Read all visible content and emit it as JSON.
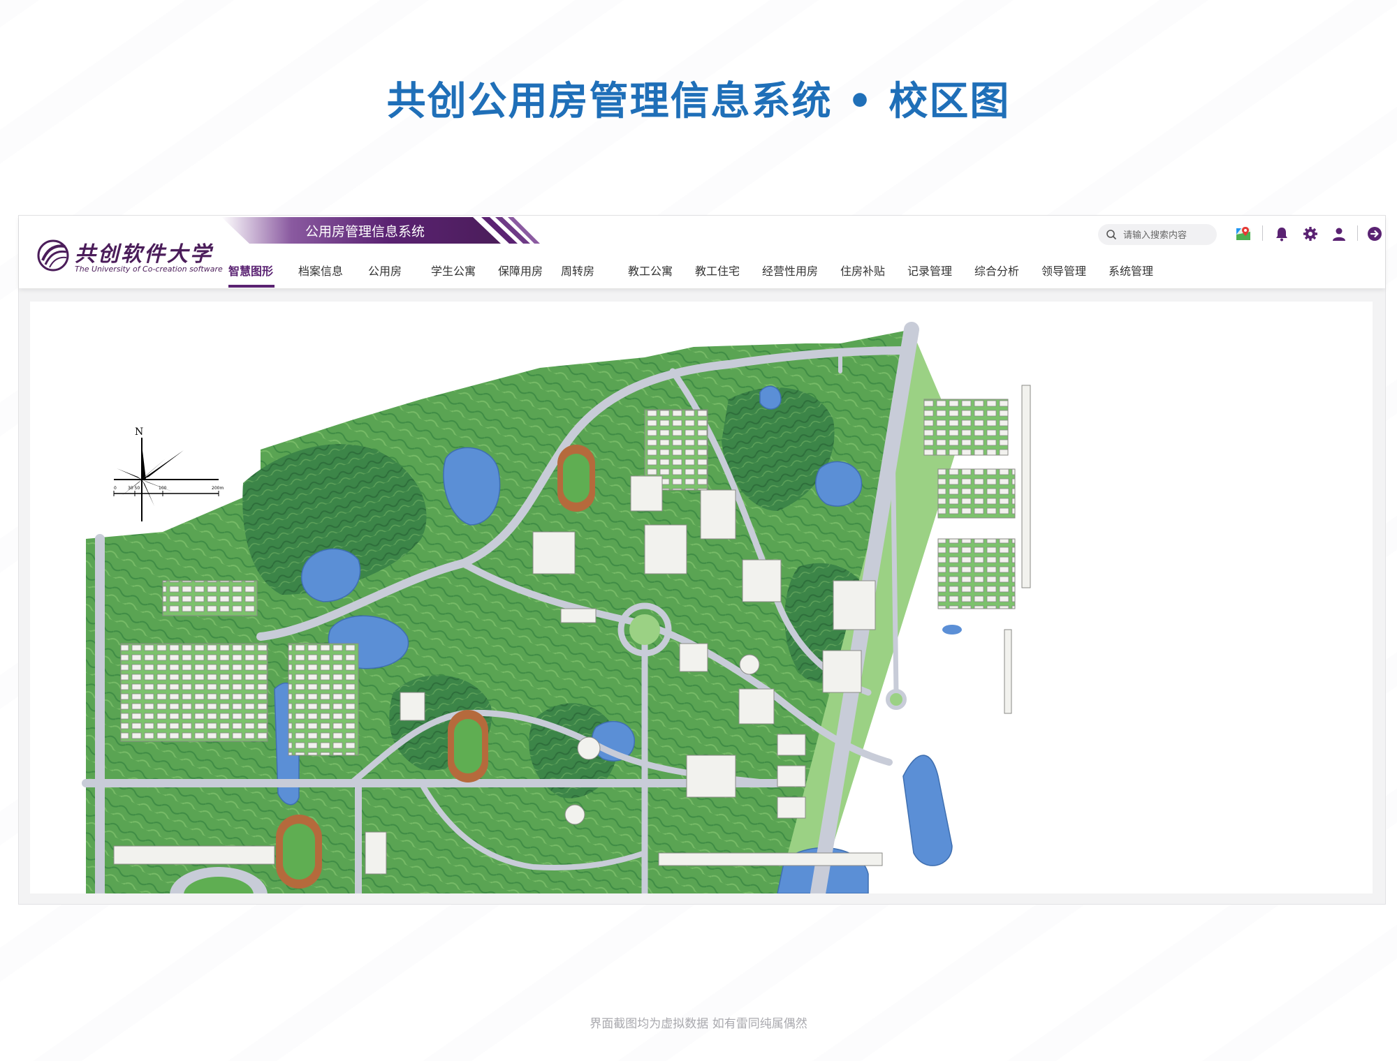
{
  "page": {
    "title": "共创公用房管理信息系统 • 校区图",
    "footer_note": "界面截图均为虚拟数据 如有雷同纯属偶然"
  },
  "header": {
    "logo_cn": "共创软件大学",
    "logo_en": "The University of Co-creation software",
    "system_name": "公用房管理信息系统",
    "search_placeholder": "请输入搜索内容",
    "icons": [
      "map-pin-icon",
      "bell-icon",
      "gear-icon",
      "user-icon",
      "logout-arrow-icon"
    ]
  },
  "nav": {
    "active_index": 0,
    "items": [
      {
        "label": "智慧图形"
      },
      {
        "label": "档案信息"
      },
      {
        "label": "公用房"
      },
      {
        "label": "学生公寓"
      },
      {
        "label": "保障用房"
      },
      {
        "label": "周转房"
      },
      {
        "label": "教工公寓"
      },
      {
        "label": "教工住宅"
      },
      {
        "label": "经营性用房"
      },
      {
        "label": "住房补贴"
      },
      {
        "label": "记录管理"
      },
      {
        "label": "综合分析"
      },
      {
        "label": "领导管理"
      },
      {
        "label": "系统管理"
      }
    ]
  },
  "map": {
    "compass_label": "N",
    "scale_labels": [
      "0",
      "30 50",
      "100",
      "200m"
    ],
    "colors": {
      "grass": "#7cc26c",
      "forest": "#3e8a48",
      "water": "#5b8fd6",
      "road": "#c8ccd8",
      "track": "#b56a3c",
      "field": "#5fae52",
      "building": "#f2f2ee"
    }
  },
  "colors": {
    "title": "#1f6fb8",
    "brand": "#5a2272"
  }
}
